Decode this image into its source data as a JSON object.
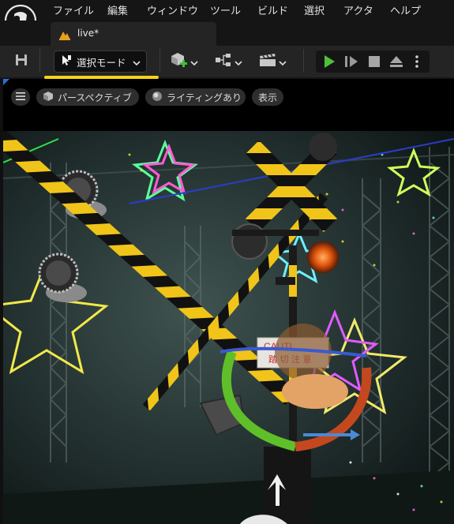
{
  "menu": {
    "items": [
      "ファイル",
      "編集",
      "ウィンドウ",
      "ツール",
      "ビルド",
      "選択",
      "アクタ",
      "ヘルプ"
    ]
  },
  "tab": {
    "label": "live*",
    "icon": "level-icon"
  },
  "toolbar": {
    "save_icon": "save-icon",
    "mode_label": "選択モード",
    "mode_icon": "select-mode-icon",
    "add_icon": "add-actor-icon",
    "blueprint_icon": "blueprint-icon",
    "cinematics_icon": "clapperboard-icon",
    "play_icon": "play-icon",
    "advance_icon": "frame-advance-icon",
    "stop_icon": "stop-icon",
    "eject_icon": "eject-icon",
    "more_icon": "more-options-icon",
    "accent_color": "#f5d312",
    "play_color": "#4fbf3a"
  },
  "viewport": {
    "menu_icon": "hamburger-icon",
    "perspective_label": "パースペクティブ",
    "lighting_label": "ライティングあり",
    "show_label": "表示",
    "sign_text_1": "CAUTI",
    "sign_text_2": "踏 切 注 意"
  }
}
